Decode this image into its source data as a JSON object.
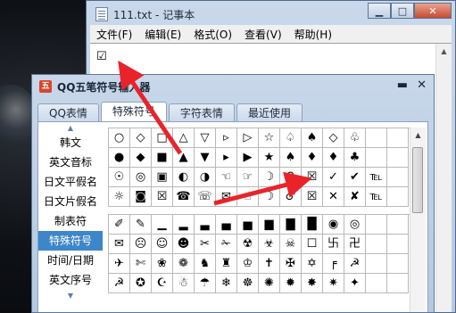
{
  "colors": {
    "arrow": "#e8242a",
    "selected_category_bg": "#3d86c9"
  },
  "notepad": {
    "title": "111.txt - 记事本",
    "menu": [
      "文件(F)",
      "编辑(E)",
      "格式(O)",
      "查看(V)",
      "帮助(H)"
    ],
    "content": "☑",
    "caption_buttons": [
      "minimize-icon",
      "maximize-icon",
      "close-icon"
    ]
  },
  "panel": {
    "logo": "五",
    "title": "QQ五笔符号输入器",
    "pin_glyph": "▬",
    "close_glyph": "✕",
    "tabs": [
      "QQ表情",
      "特殊符号",
      "字符表情",
      "最近使用"
    ],
    "active_tab": 1,
    "categories": [
      "韩文",
      "英文音标",
      "日文平假名",
      "日文片假名",
      "制表符",
      "特殊符号",
      "时间/日期",
      "英文序号"
    ],
    "active_category": 5,
    "symbols_top": [
      [
        "○",
        "◇",
        "□",
        "△",
        "▽",
        "▹",
        "▷",
        "☆",
        "♤",
        "♠",
        "◇",
        "♧",
        "",
        ""
      ],
      [
        "●",
        "◆",
        "■",
        "▲",
        "▼",
        "▸",
        "▶",
        "★",
        "♠",
        "♦",
        "♦",
        "♣",
        "",
        ""
      ],
      [
        "☉",
        "◎",
        "▣",
        "◐",
        "◑",
        "☜",
        "☞",
        "☽",
        "♀",
        "☒",
        "✓",
        "✔",
        "℡",
        ""
      ],
      [
        "☼",
        "◙",
        "☒",
        "☎",
        "☏",
        "✉",
        "☝",
        "☽",
        "♂",
        "☒",
        "✕",
        "✘",
        "℡",
        ""
      ]
    ],
    "symbols_bottom": [
      [
        "✐",
        "✎",
        "▁",
        "▂",
        "▃",
        "▄",
        "▅",
        "▆",
        "▇",
        "█",
        "◉",
        "◎",
        "",
        ""
      ],
      [
        "✉",
        "☹",
        "☺",
        "☻",
        "✂",
        "✁",
        "☢",
        "☣",
        "☠",
        "☐",
        "卐",
        "卍",
        "",
        ""
      ],
      [
        "✈",
        "✄",
        "❀",
        "❁",
        "♞",
        "♜",
        "♔",
        "✝",
        "✠",
        "✡",
        "╒",
        "☭",
        "",
        ""
      ],
      [
        "☭",
        "✪",
        "☪",
        "☃",
        "☂",
        "❄",
        "☸",
        "✺",
        "✹",
        "✸",
        "✷",
        "✦",
        "",
        ""
      ]
    ]
  }
}
